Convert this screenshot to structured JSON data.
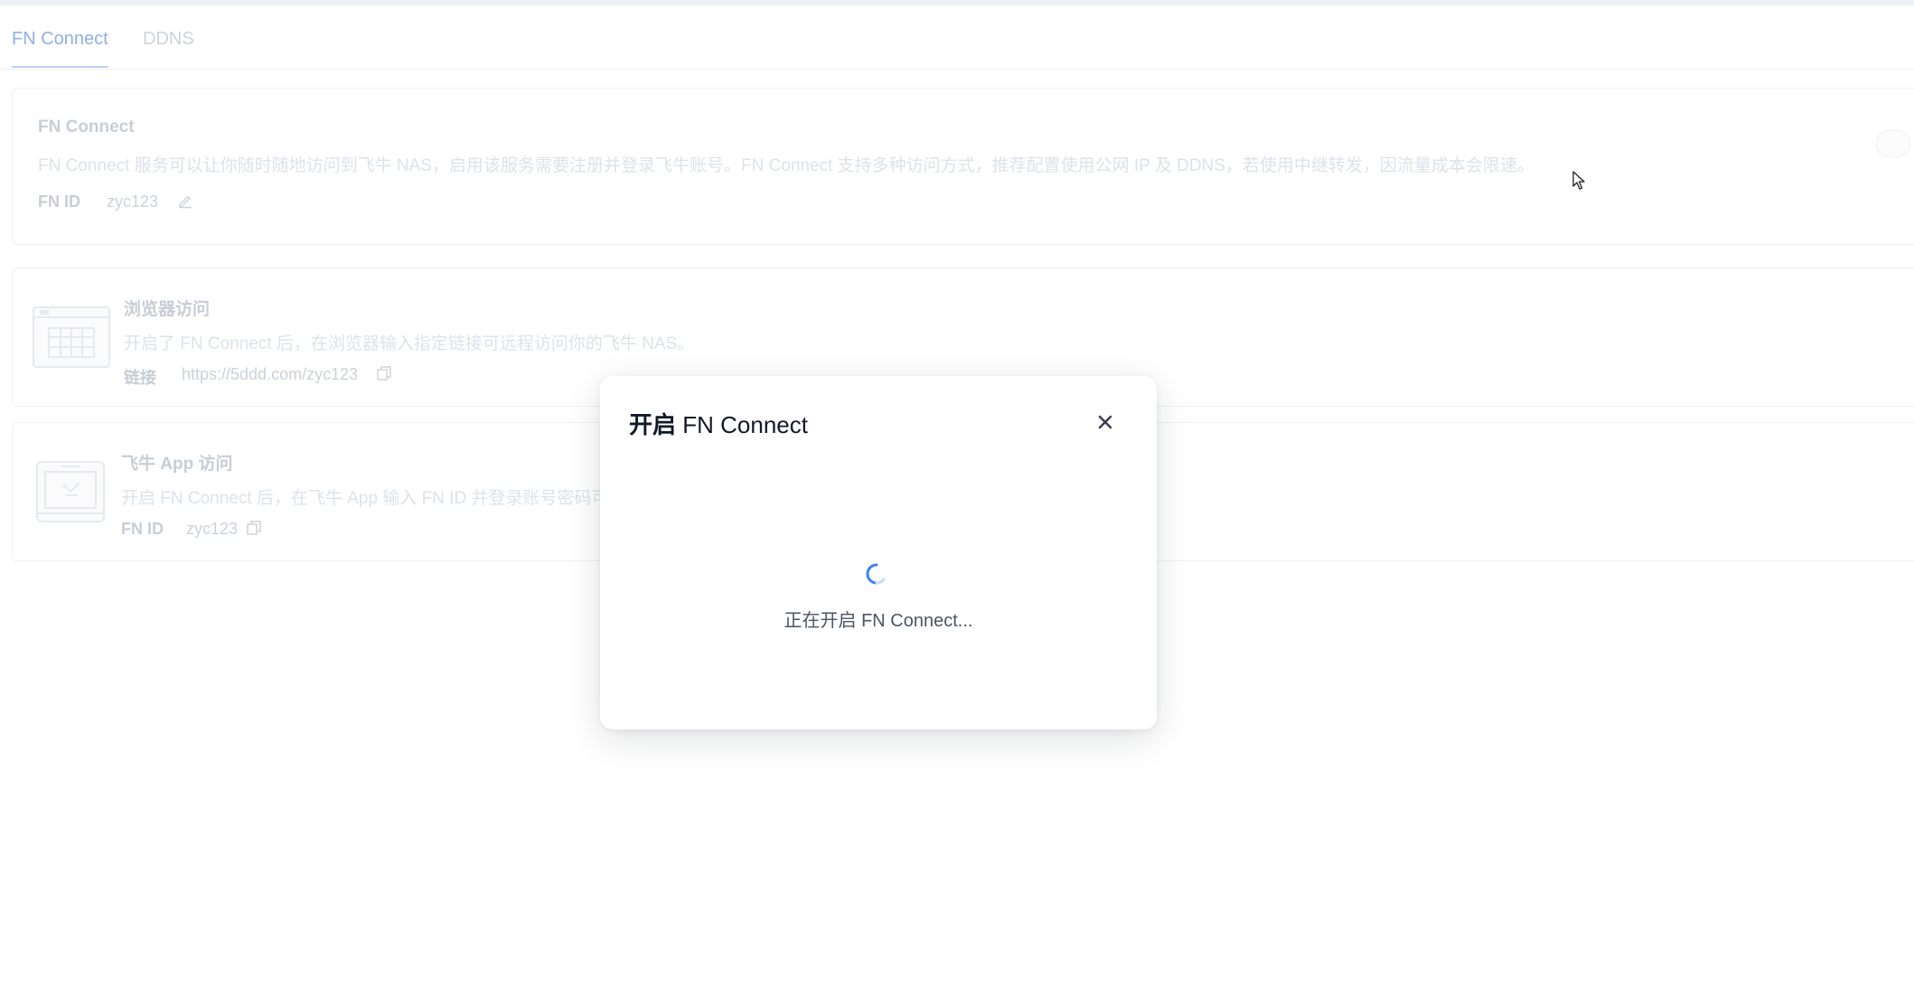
{
  "tabs": [
    {
      "label": "FN Connect",
      "active": true
    },
    {
      "label": "DDNS",
      "active": false
    }
  ],
  "fn_connect_card": {
    "title": "FN Connect",
    "description": "FN Connect 服务可以让你随时随地访问到飞牛 NAS，启用该服务需要注册并登录飞牛账号。FN Connect 支持多种访问方式，推荐配置使用公网 IP 及 DDNS，若使用中继转发，因流量成本会限速。",
    "id_label": "FN ID",
    "id_value": "zyc123",
    "icons": {
      "edit": "pencil-icon"
    }
  },
  "browser_card": {
    "title": "浏览器访问",
    "description": "开启了 FN Connect 后，在浏览器输入指定链接可远程访问你的飞牛 NAS。",
    "link_label": "链接",
    "link_value": "https://5ddd.com/zyc123",
    "icons": {
      "illustration": "browser-window-icon",
      "copy": "copy-icon"
    }
  },
  "app_card": {
    "title": "飞牛 App 访问",
    "description": "开启 FN Connect 后，在飞牛 App 输入 FN ID 并登录账号密码可",
    "id_label": "FN ID",
    "id_value": "zyc123",
    "icons": {
      "illustration": "tablet-app-icon",
      "copy": "copy-icon"
    }
  },
  "modal": {
    "title_prefix": "开启",
    "title_suffix": " FN Connect",
    "status": "正在开启 FN Connect...",
    "icons": {
      "close": "close-icon",
      "spinner": "loading-spinner-icon"
    }
  },
  "colors": {
    "accent": "#3b82f6",
    "close_icon": "#374151",
    "faded_text": "#c8cdd5"
  }
}
